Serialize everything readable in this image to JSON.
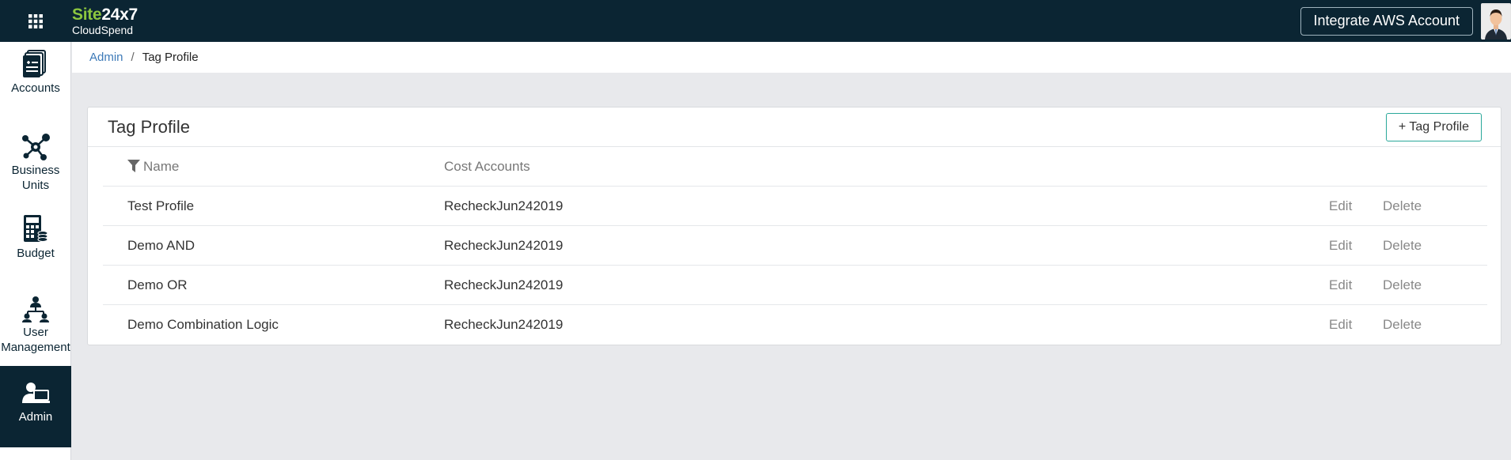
{
  "topbar": {
    "grid_icon": "apps-grid-icon",
    "brand_site": "Site",
    "brand_num": "24x7",
    "brand_sub": "CloudSpend",
    "integrate_label": "Integrate AWS Account",
    "avatar_icon": "user-avatar-icon"
  },
  "sidebar": {
    "items": [
      {
        "label": "Accounts",
        "icon": "accounts-icon"
      },
      {
        "label": "Business Units",
        "icon": "business-units-icon"
      },
      {
        "label": "Budget",
        "icon": "budget-icon"
      },
      {
        "label": "User Management",
        "icon": "user-management-icon"
      },
      {
        "label": "Admin",
        "icon": "admin-icon",
        "active": true
      }
    ]
  },
  "breadcrumb": {
    "parent": "Admin",
    "separator": "/",
    "current": "Tag Profile"
  },
  "card": {
    "title": "Tag Profile",
    "add_label": "+ Tag Profile"
  },
  "table": {
    "headers": {
      "name": "Name",
      "cost_accounts": "Cost Accounts"
    },
    "rows": [
      {
        "name": "Test Profile",
        "cost_accounts": "RecheckJun242019",
        "edit": "Edit",
        "delete": "Delete"
      },
      {
        "name": "Demo AND",
        "cost_accounts": "RecheckJun242019",
        "edit": "Edit",
        "delete": "Delete"
      },
      {
        "name": "Demo OR",
        "cost_accounts": "RecheckJun242019",
        "edit": "Edit",
        "delete": "Delete"
      },
      {
        "name": "Demo Combination Logic",
        "cost_accounts": "RecheckJun242019",
        "edit": "Edit",
        "delete": "Delete"
      }
    ]
  },
  "colors": {
    "topbar_bg": "#0b2533",
    "brand_green": "#8cc63f",
    "accent_teal": "#2aa89a",
    "link_blue": "#3d7ab8",
    "page_bg": "#e8e9ec"
  }
}
